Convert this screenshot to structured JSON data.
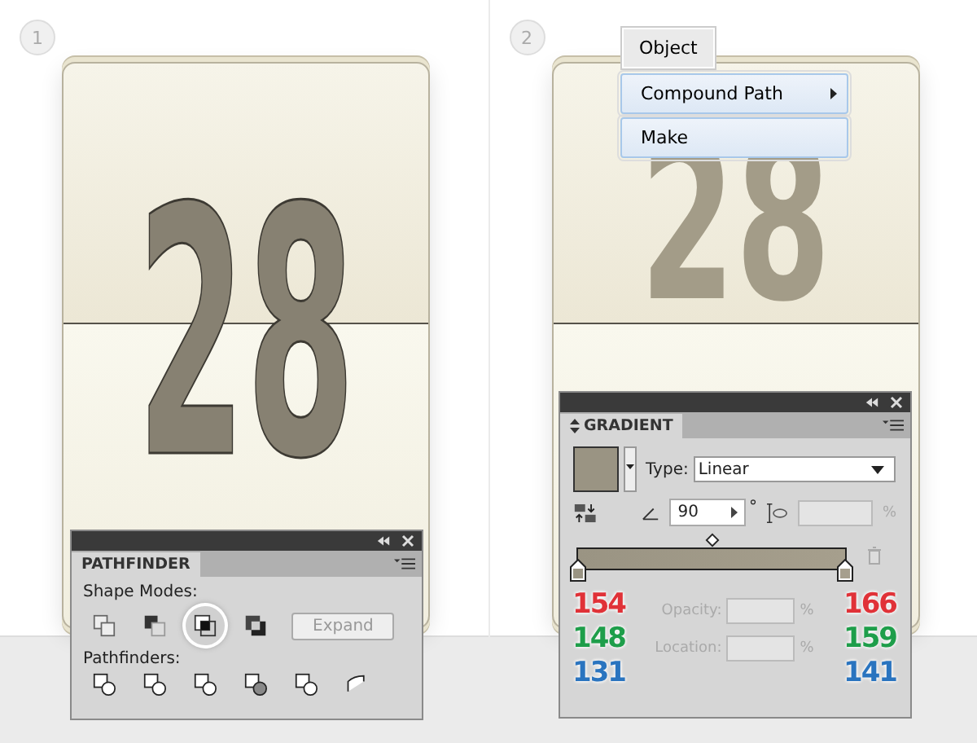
{
  "steps": [
    {
      "number": "1",
      "digits": "28",
      "outlined": true
    },
    {
      "number": "2",
      "digits": "28",
      "outlined": false
    }
  ],
  "menu": {
    "title": "Object",
    "items": [
      {
        "label": "Compound Path",
        "submenu": true
      },
      {
        "label": "Make",
        "submenu": false
      }
    ]
  },
  "pathfinder": {
    "title": "PATHFINDER",
    "shape_modes_label": "Shape Modes:",
    "shape_modes": [
      {
        "selected": false
      },
      {
        "selected": false
      },
      {
        "selected": true
      },
      {
        "selected": false
      }
    ],
    "expand_button": "Expand",
    "pathfinders_label": "Pathfinders:"
  },
  "gradient": {
    "title": "GRADIENT",
    "type_label": "Type:",
    "type_value": "Linear",
    "angle": "90",
    "degree": "°",
    "aspect_unit": "%",
    "opacity_label": "Opacity:",
    "opacity_unit": "%",
    "location_label": "Location:",
    "location_unit": "%",
    "stops": [
      {
        "color": "#9a9483",
        "r": "154",
        "g": "148",
        "b": "131"
      },
      {
        "color": "#a69f8d",
        "r": "166",
        "g": "159",
        "b": "141"
      }
    ]
  }
}
